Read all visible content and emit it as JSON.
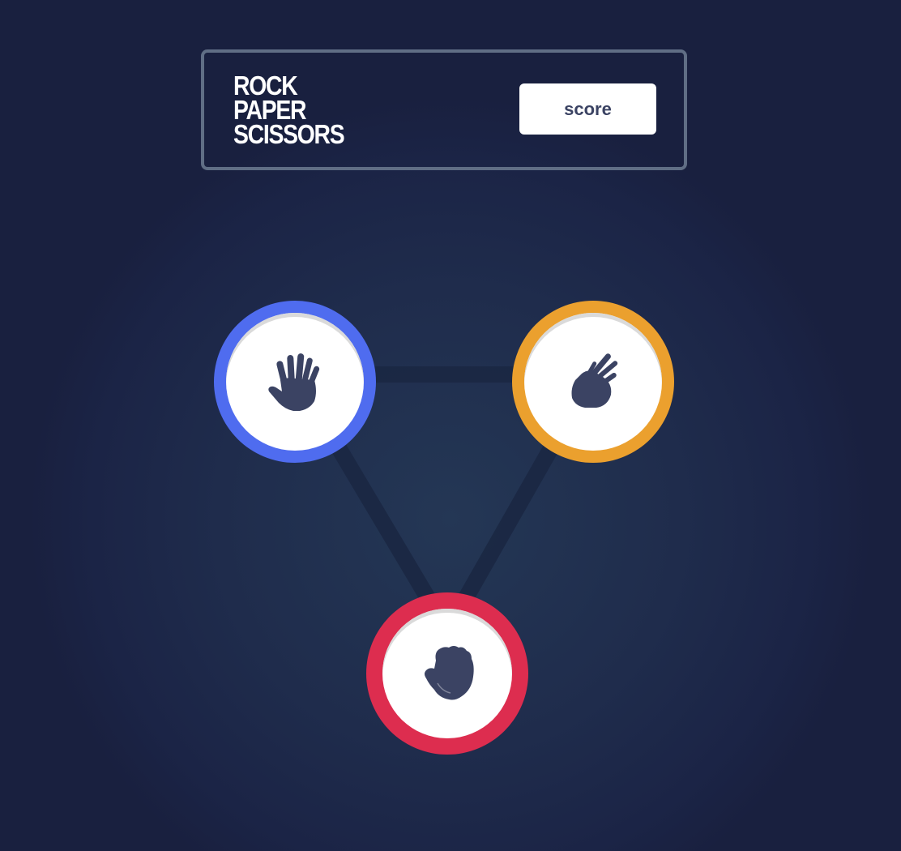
{
  "header": {
    "title_lines": [
      "ROCK",
      "PAPER",
      "SCISSORS"
    ],
    "score_label": "score"
  },
  "choices": [
    {
      "name": "paper",
      "icon": "paper-hand-icon",
      "ring_color": "#4f6cef"
    },
    {
      "name": "scissors",
      "icon": "scissors-hand-icon",
      "ring_color": "#eba02e"
    },
    {
      "name": "rock",
      "icon": "rock-fist-icon",
      "ring_color": "#dd2d4f"
    }
  ],
  "colors": {
    "icon": "#3b4363",
    "outline": "#606e85",
    "background": "#1f2c4c"
  }
}
